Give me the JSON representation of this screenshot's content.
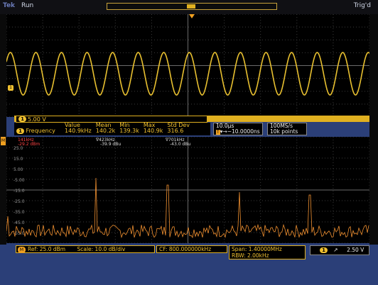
{
  "status": {
    "brand": "Tek",
    "run": "Run",
    "trig": "Trig'd"
  },
  "channel": {
    "number": "1",
    "scale": "5.00 V"
  },
  "measurement": {
    "headers": [
      "Value",
      "Mean",
      "Min",
      "Max",
      "Std Dev"
    ],
    "name": "Frequency",
    "values": [
      "140.9kHz",
      "140.2k",
      "139.3k",
      "140.9k",
      "316.6"
    ]
  },
  "horizontal": {
    "scale": "10.0µs",
    "delay": "▾→−10.0000ns"
  },
  "acquisition": {
    "rate": "100MS/s",
    "points": "10k points"
  },
  "time_screen": {
    "cycles": 14.2,
    "trace_color": "#e8c030"
  },
  "freq_screen": {
    "ylabels": [
      "25.0",
      "15.0",
      "5.00",
      "-5.00",
      "-15.0",
      "-25.0",
      "-35.0",
      "-45.0",
      "-55.0"
    ],
    "markers": [
      {
        "freq": "141kHz",
        "level": "-29.2 dBm",
        "color": "#ff4444"
      },
      {
        "freq": "423kHz",
        "level": "-39.9 dBu",
        "color": "#dddddd"
      },
      {
        "freq": "701kHz",
        "level": "-43.0 dBu",
        "color": "#dddddd"
      }
    ],
    "trace_color": "#f09030"
  },
  "bottom": {
    "ref_badge": "M",
    "ref": "Ref: 25.0 dBm",
    "scale": "Scale: 10.0 dB/div",
    "cf": "CF: 800.000000kHz",
    "span": "Span:  1.40000MHz",
    "rbw": "RBW:    2.00kHz",
    "trig_ch": "1",
    "trig_slope": "↗",
    "trig_level": "2.50 V"
  }
}
